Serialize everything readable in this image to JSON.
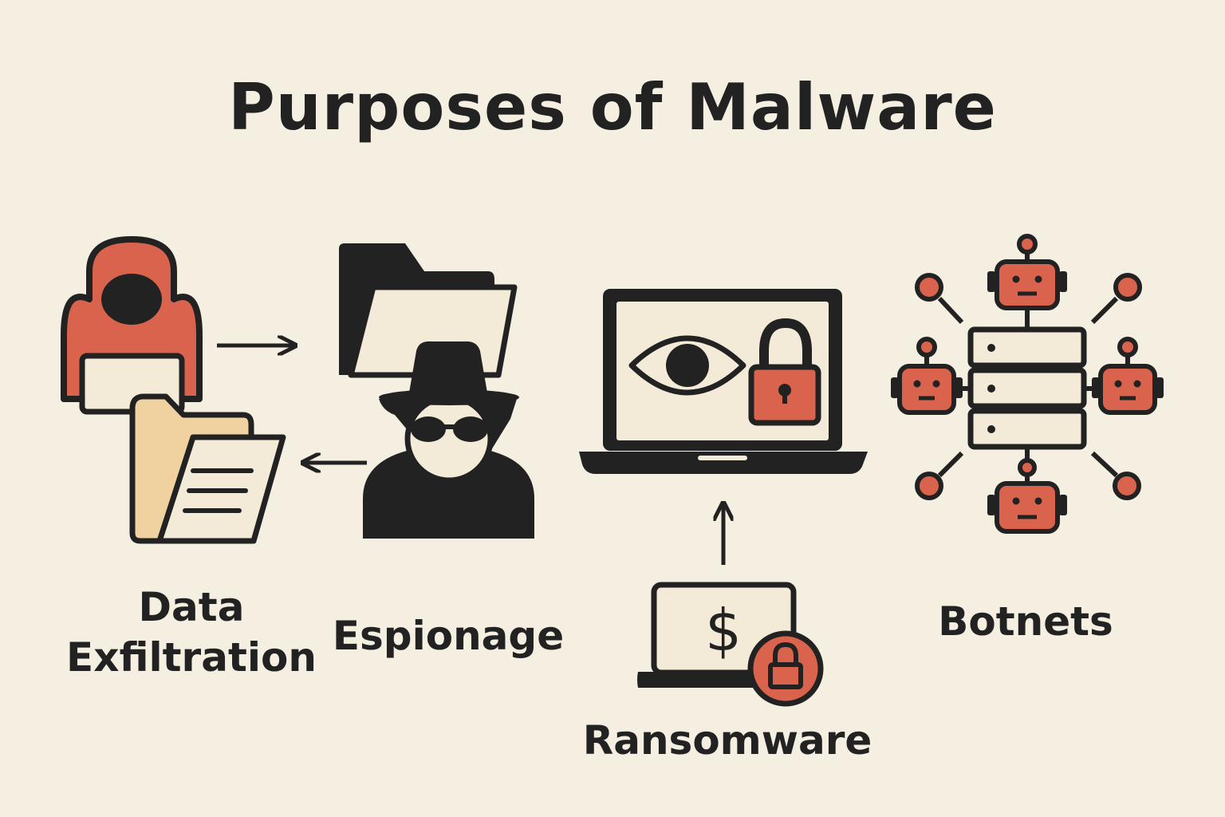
{
  "title": "Purposes of Malware",
  "colors": {
    "background": "#f5efe2",
    "ink": "#222222",
    "accent": "#d9634c",
    "paper": "#f3ead8",
    "folder": "#efd29f"
  },
  "items": [
    {
      "label_lines": [
        "Data",
        "Exfiltration"
      ],
      "icons": [
        "hacker-icon",
        "laptop-icon",
        "folder-icon",
        "document-icon"
      ]
    },
    {
      "label_lines": [
        "Espionage"
      ],
      "icons": [
        "spy-icon",
        "folder-icon"
      ]
    },
    {
      "label_lines": [
        "Ransomware"
      ],
      "icons": [
        "laptop-icon",
        "eye-icon",
        "padlock-icon",
        "dollar-icon"
      ]
    },
    {
      "label_lines": [
        "Botnets"
      ],
      "icons": [
        "server-icon",
        "robot-icon",
        "node-icon"
      ]
    }
  ]
}
